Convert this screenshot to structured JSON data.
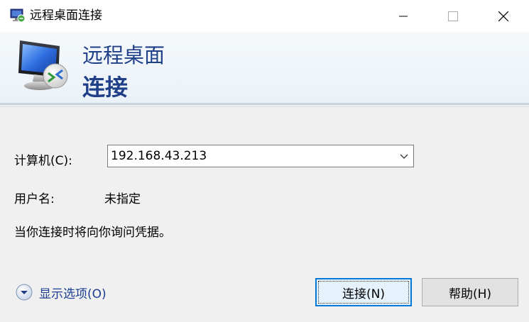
{
  "window": {
    "title": "远程桌面连接"
  },
  "banner": {
    "line1": "远程桌面",
    "line2": "连接"
  },
  "form": {
    "computer_label": "计算机(C):",
    "computer_value": "192.168.43.213",
    "username_label": "用户名:",
    "username_value": "未指定",
    "info_text": "当你连接时将向你询问凭据。"
  },
  "options": {
    "label": "显示选项(O)"
  },
  "buttons": {
    "connect_label": "连接(N)",
    "help_label": "帮助(H)"
  },
  "icons": {
    "app": "remote-desktop-icon",
    "banner": "monitor-icon",
    "combo_arrow": "chevron-down-icon",
    "options": "expand-circle-icon",
    "minimize": "minimize-icon",
    "maximize": "maximize-icon",
    "close": "close-icon"
  },
  "colors": {
    "banner_text": "#1f3f88",
    "focus_border": "#0078d7",
    "link_text": "#1a3d8f"
  }
}
